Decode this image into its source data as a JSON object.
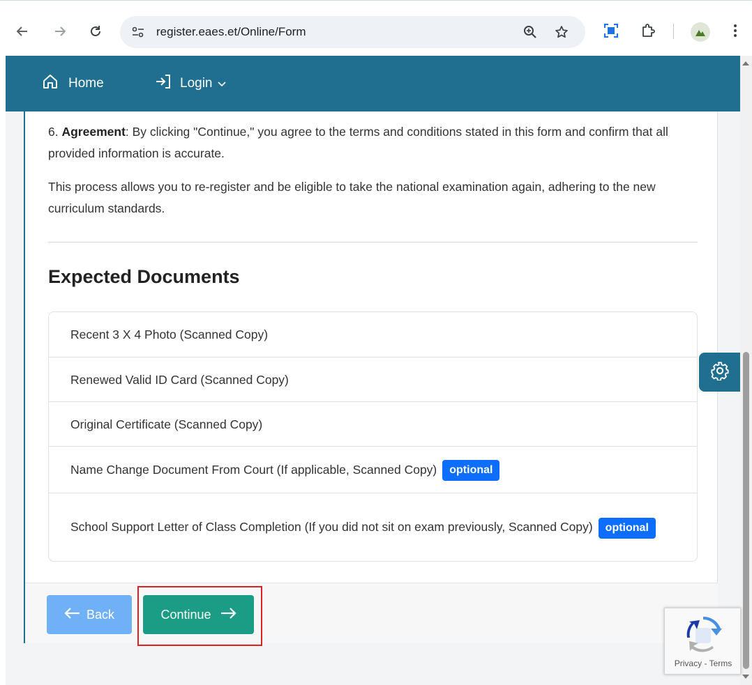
{
  "browser": {
    "url": "register.eaes.et/Online/Form",
    "icons": [
      "back-arrow-icon",
      "forward-arrow-icon",
      "reload-icon",
      "site-settings-icon",
      "zoom-icon",
      "bookmark-star-icon",
      "screenshot-icon",
      "extensions-icon",
      "profile-avatar",
      "more-vert-icon"
    ]
  },
  "navbar": {
    "home_label": "Home",
    "login_label": "Login",
    "color": "#216f90"
  },
  "content": {
    "agreement_number": "6.",
    "agreement_title": "Agreement",
    "agreement_text": ": By clicking \"Continue,\" you agree to the terms and conditions stated in this form and confirm that all provided information is accurate.",
    "process_text": "This process allows you to re-register and be eligible to take the national examination again, adhering to the new curriculum standards.",
    "docs_heading": "Expected Documents",
    "documents": [
      {
        "text": "Recent 3 X 4 Photo (Scanned Copy)",
        "badge": ""
      },
      {
        "text": "Renewed Valid ID Card (Scanned Copy)",
        "badge": ""
      },
      {
        "text": "Original Certificate (Scanned Copy)",
        "badge": ""
      },
      {
        "text": "Name Change Document From Court (If applicable, Scanned Copy)",
        "badge": "optional"
      },
      {
        "text": "School Support Letter of Class Completion (If you did not sit on exam previously, Scanned Copy)",
        "badge": "optional"
      }
    ]
  },
  "footer": {
    "back_label": "Back",
    "continue_label": "Continue"
  },
  "recaptcha": {
    "privacy": "Privacy",
    "separator": " - ",
    "terms": "Terms"
  },
  "colors": {
    "accent": "#216f90",
    "continue": "#1b9c85",
    "back": "#6fb0f7",
    "badge": "#0d6efd",
    "highlight": "#e02020"
  }
}
